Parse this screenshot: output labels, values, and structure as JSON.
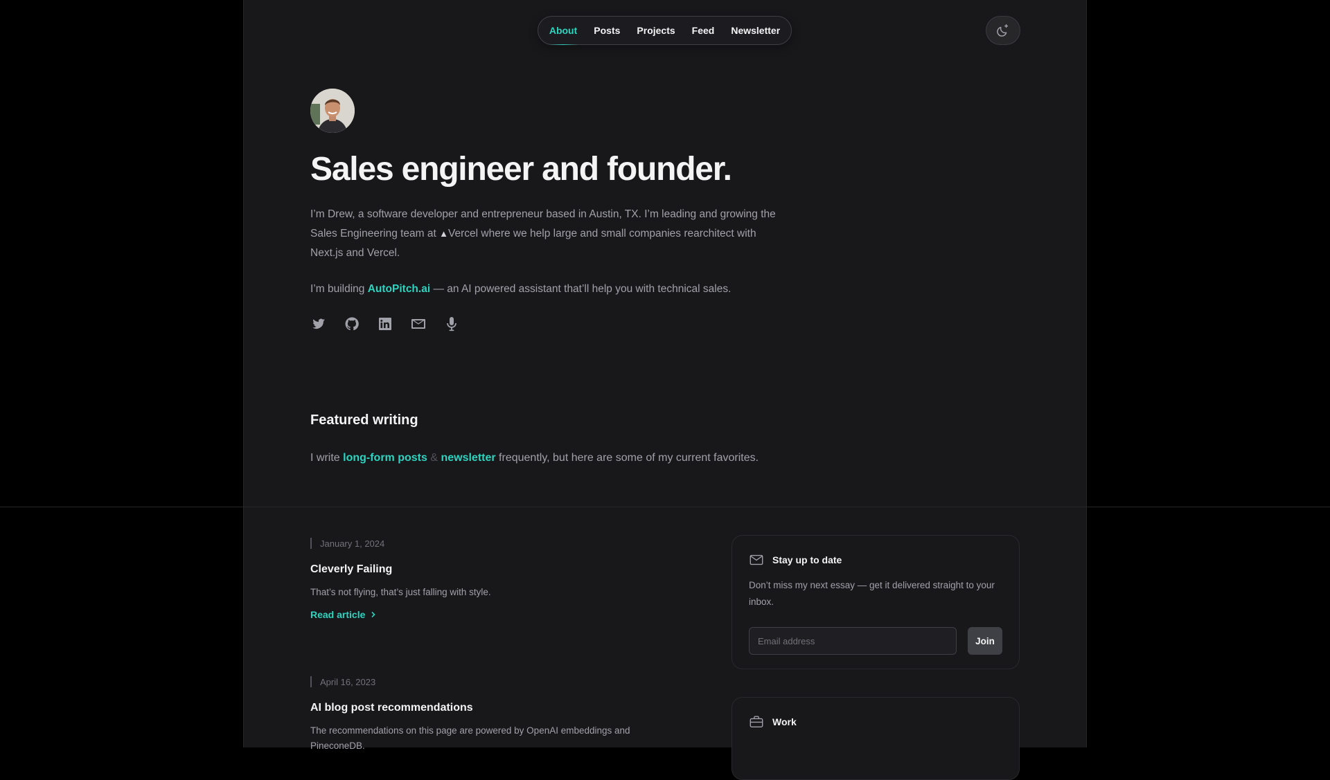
{
  "nav": {
    "items": [
      {
        "label": "About",
        "active": true
      },
      {
        "label": "Posts",
        "active": false
      },
      {
        "label": "Projects",
        "active": false
      },
      {
        "label": "Feed",
        "active": false
      },
      {
        "label": "Newsletter",
        "active": false
      }
    ],
    "theme_toggle_icon": "moon-sparkle-icon"
  },
  "hero": {
    "title": "Sales engineer and founder.",
    "intro_before_brand": "I’m Drew, a software developer and entrepreneur based in Austin, TX. I’m leading and growing the Sales Engineering team at ",
    "brand_logo": "▲",
    "brand_name": "Vercel",
    "intro_after_brand": " where we help large and small companies rearchitect with Next.js and Vercel.",
    "building_before": "I’m building ",
    "building_link": "AutoPitch.ai",
    "building_after": " — an AI powered assistant that’ll help you with technical sales.",
    "social_icons": [
      "twitter-icon",
      "github-icon",
      "linkedin-icon",
      "mail-icon",
      "microphone-icon"
    ]
  },
  "featured": {
    "title": "Featured writing",
    "text_before": "I write ",
    "link_posts": "long-form posts",
    "amp": "&",
    "link_newsletter": "newsletter",
    "text_after": " frequently, but here are some of my current favorites."
  },
  "articles": [
    {
      "date": "January 1, 2024",
      "title": "Cleverly Failing",
      "description": "That’s not flying, that’s just falling with style.",
      "cta": "Read article"
    },
    {
      "date": "April 16, 2023",
      "title": "AI blog post recommendations",
      "description": "The recommendations on this page are powered by OpenAI embeddings and PineconeDB."
    }
  ],
  "newsletter_card": {
    "title": "Stay up to date",
    "description": "Don’t miss my next essay — get it delivered straight to your inbox.",
    "email_placeholder": "Email address",
    "join_label": "Join"
  },
  "work_card": {
    "title": "Work"
  },
  "colors": {
    "accent": "#2dd4bf",
    "page_bg": "#18181b",
    "outer_bg": "#000000"
  }
}
